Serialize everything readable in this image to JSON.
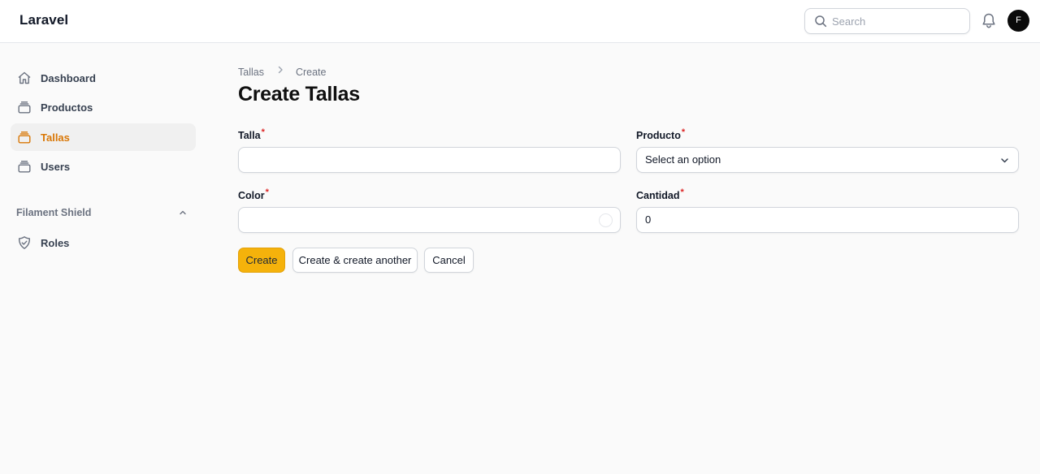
{
  "app": {
    "brand": "Laravel"
  },
  "header": {
    "search_placeholder": "Search",
    "avatar_initial": "F"
  },
  "sidebar": {
    "items": [
      {
        "label": "Dashboard",
        "icon": "home-icon",
        "active": false
      },
      {
        "label": "Productos",
        "icon": "collection-icon",
        "active": false
      },
      {
        "label": "Tallas",
        "icon": "collection-icon",
        "active": true
      },
      {
        "label": "Users",
        "icon": "collection-icon",
        "active": false
      }
    ],
    "group": {
      "label": "Filament Shield",
      "expanded": true,
      "items": [
        {
          "label": "Roles",
          "icon": "shield-check-icon"
        }
      ]
    }
  },
  "breadcrumb": {
    "parent": "Tallas",
    "current": "Create"
  },
  "page": {
    "title": "Create Tallas"
  },
  "form": {
    "required_marker": "*",
    "talla": {
      "label": "Talla",
      "value": ""
    },
    "producto": {
      "label": "Producto",
      "selected": "Select an option"
    },
    "color": {
      "label": "Color",
      "value": ""
    },
    "cantidad": {
      "label": "Cantidad",
      "value": "0"
    }
  },
  "actions": {
    "create": "Create",
    "create_another": "Create & create another",
    "cancel": "Cancel"
  },
  "colors": {
    "accent": "#d97706",
    "primary_button": "#f5b20b",
    "required": "#dc2626"
  }
}
